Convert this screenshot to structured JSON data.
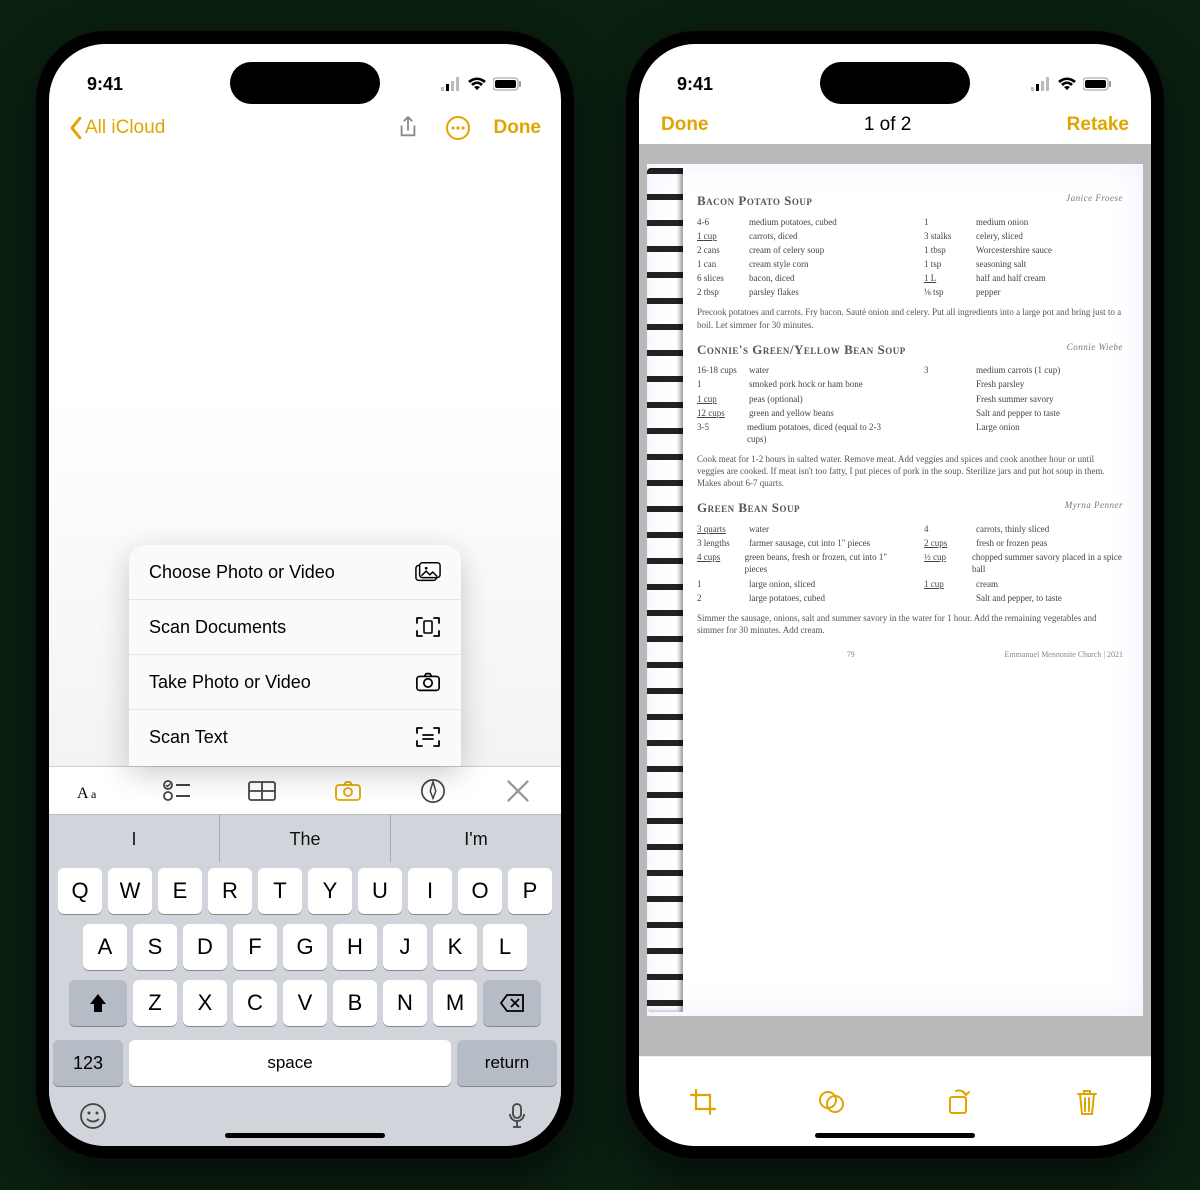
{
  "status": {
    "time": "9:41"
  },
  "phone1": {
    "nav": {
      "back": "All iCloud",
      "done": "Done"
    },
    "menu": [
      {
        "label": "Choose Photo or Video"
      },
      {
        "label": "Scan Documents"
      },
      {
        "label": "Take Photo or Video"
      },
      {
        "label": "Scan Text"
      }
    ],
    "suggestions": [
      "I",
      "The",
      "I'm"
    ],
    "keys_row1": [
      "Q",
      "W",
      "E",
      "R",
      "T",
      "Y",
      "U",
      "I",
      "O",
      "P"
    ],
    "keys_row2": [
      "A",
      "S",
      "D",
      "F",
      "G",
      "H",
      "J",
      "K",
      "L"
    ],
    "keys_row3": [
      "Z",
      "X",
      "C",
      "V",
      "B",
      "N",
      "M"
    ],
    "bottom": {
      "num": "123",
      "space": "space",
      "ret": "return"
    }
  },
  "phone2": {
    "nav": {
      "done": "Done",
      "counter": "1 of 2",
      "retake": "Retake"
    },
    "recipes": [
      {
        "title": "Bacon Potato Soup",
        "author": "Janice Froese",
        "left": [
          {
            "amt": "4-6",
            "item": "medium potatoes, cubed"
          },
          {
            "amt": "1 cup",
            "ul": true,
            "item": "carrots, diced"
          },
          {
            "amt": "2 cans",
            "item": "cream of celery soup"
          },
          {
            "amt": "1 can",
            "item": "cream style corn"
          },
          {
            "amt": "6 slices",
            "item": "bacon, diced"
          },
          {
            "amt": "2 tbsp",
            "item": "parsley flakes"
          }
        ],
        "right": [
          {
            "amt": "1",
            "item": "medium onion"
          },
          {
            "amt": "3 stalks",
            "item": "celery, sliced"
          },
          {
            "amt": "1 tbsp",
            "item": "Worcestershire sauce"
          },
          {
            "amt": "1 tsp",
            "item": "seasoning salt"
          },
          {
            "amt": "1 L",
            "ul": true,
            "item": "half and half cream"
          },
          {
            "amt": "⅛ tsp",
            "item": "pepper"
          }
        ],
        "instructions": "Precook potatoes and carrots. Fry bacon. Sauté onion and celery. Put all ingredients into a large pot and bring just to a boil. Let simmer for 30 minutes."
      },
      {
        "title": "Connie's Green/Yellow Bean Soup",
        "author": "Connie Wiebe",
        "left": [
          {
            "amt": "16-18 cups",
            "item": "water"
          },
          {
            "amt": "1",
            "item": "smoked pork hock or ham bone"
          },
          {
            "amt": "1 cup",
            "ul": true,
            "item": "peas (optional)"
          },
          {
            "amt": "12 cups",
            "ul": true,
            "item": "green and yellow beans"
          },
          {
            "amt": "3-5",
            "item": "medium potatoes, diced (equal to 2-3 cups)"
          }
        ],
        "right": [
          {
            "amt": "3",
            "item": "medium carrots (1 cup)"
          },
          {
            "amt": "",
            "item": "Fresh parsley"
          },
          {
            "amt": "",
            "item": "Fresh summer savory"
          },
          {
            "amt": "",
            "item": "Salt and pepper to taste"
          },
          {
            "amt": "",
            "item": "Large onion"
          }
        ],
        "instructions": "Cook meat for 1-2 hours in salted water. Remove meat. Add veggies and spices and cook another hour or until veggies are cooked. If meat isn't too fatty, I put pieces of pork in the soup. Sterilize jars and put hot soup in them. Makes about 6-7 quarts."
      },
      {
        "title": "Green Bean Soup",
        "author": "Myrna Penner",
        "left": [
          {
            "amt": "3 quarts",
            "ul": true,
            "item": "water"
          },
          {
            "amt": "3 lengths",
            "item": "farmer sausage, cut into 1\" pieces"
          },
          {
            "amt": "4 cups",
            "ul": true,
            "item": "green beans, fresh or frozen, cut into 1\" pieces"
          },
          {
            "amt": "1",
            "item": "large onion, sliced"
          },
          {
            "amt": "2",
            "item": "large potatoes, cubed"
          }
        ],
        "right": [
          {
            "amt": "4",
            "item": "carrots, thinly sliced"
          },
          {
            "amt": "2 cups",
            "ul": true,
            "item": "fresh or frozen peas"
          },
          {
            "amt": "½ cup",
            "ul": true,
            "item": "chopped summer savory placed in a spice ball"
          },
          {
            "amt": "1 cup",
            "ul": true,
            "item": "cream"
          },
          {
            "amt": "",
            "item": "Salt and pepper, to taste"
          }
        ],
        "instructions": "Simmer the sausage, onions, salt and summer savory in the water for 1 hour. Add the remaining vegetables and simmer for 30 minutes. Add cream."
      }
    ],
    "footer": {
      "page": "79",
      "credit": "Emmanuel Mennonite Church | 2021"
    }
  }
}
